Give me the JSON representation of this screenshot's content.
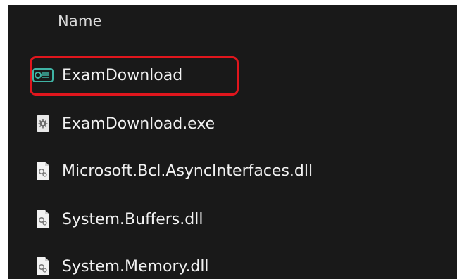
{
  "file_list": {
    "column_header": "Name",
    "items": [
      {
        "name": "ExamDownload",
        "icon": "config-file-icon",
        "highlighted": true
      },
      {
        "name": "ExamDownload.exe",
        "icon": "exe-file-icon",
        "highlighted": false
      },
      {
        "name": "Microsoft.Bcl.AsyncInterfaces.dll",
        "icon": "dll-file-icon",
        "highlighted": false
      },
      {
        "name": "System.Buffers.dll",
        "icon": "dll-file-icon",
        "highlighted": false
      },
      {
        "name": "System.Memory.dll",
        "icon": "dll-file-icon",
        "highlighted": false
      }
    ]
  },
  "colors": {
    "background": "#191919",
    "text": "#f2f2f2",
    "highlight_border": "#e0161d",
    "config_icon": "#3fb3a4"
  }
}
